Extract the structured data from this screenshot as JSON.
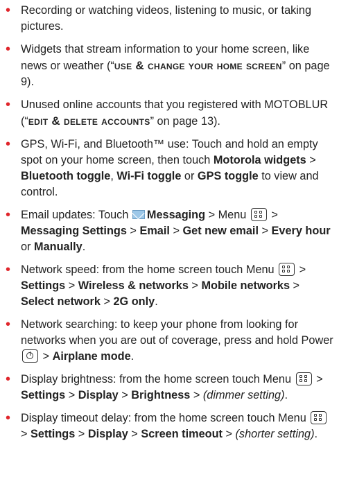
{
  "accent_color": "#e0252b",
  "items": [
    {
      "segments": [
        {
          "t": "Recording or watching videos, listening to music, or taking pictures."
        }
      ]
    },
    {
      "segments": [
        {
          "t": "Widgets that stream information to your home screen, like news or weather (“"
        },
        {
          "t": "Use & Change Your Home Screen",
          "s": "sc"
        },
        {
          "t": "” on page 9)."
        }
      ]
    },
    {
      "segments": [
        {
          "t": "Unused online accounts that you registered with MOTOBLUR (“"
        },
        {
          "t": "Edit & Delete Accounts",
          "s": "sc"
        },
        {
          "t": "” on page 13)."
        }
      ]
    },
    {
      "segments": [
        {
          "t": "GPS, Wi-Fi, and Bluetooth™ use: Touch and hold an empty spot on your home screen, then touch "
        },
        {
          "t": "Motorola widgets",
          "s": "b"
        },
        {
          "t": " > "
        },
        {
          "t": "Bluetooth toggle",
          "s": "b"
        },
        {
          "t": ", "
        },
        {
          "t": "Wi-Fi toggle",
          "s": "b"
        },
        {
          "t": " or "
        },
        {
          "t": "GPS toggle",
          "s": "b"
        },
        {
          "t": " to view and control."
        }
      ]
    },
    {
      "segments": [
        {
          "t": "Email updates: Touch "
        },
        {
          "icon": "mail-icon"
        },
        {
          "t": "Messaging",
          "s": "b"
        },
        {
          "t": " > Menu "
        },
        {
          "icon": "menu-icon"
        },
        {
          "t": " > "
        },
        {
          "t": "Messaging Settings",
          "s": "b"
        },
        {
          "t": " > "
        },
        {
          "t": "Email",
          "s": "b"
        },
        {
          "t": " > "
        },
        {
          "t": "Get new email",
          "s": "b"
        },
        {
          "t": " > "
        },
        {
          "t": "Every hour",
          "s": "b"
        },
        {
          "t": " or "
        },
        {
          "t": "Manually",
          "s": "b"
        },
        {
          "t": "."
        }
      ]
    },
    {
      "segments": [
        {
          "t": "Network speed: from the home screen touch Menu "
        },
        {
          "icon": "menu-icon"
        },
        {
          "t": " > "
        },
        {
          "t": "Settings",
          "s": "b"
        },
        {
          "t": " > "
        },
        {
          "t": "Wireless & networks",
          "s": "b"
        },
        {
          "t": " > "
        },
        {
          "t": "Mobile networks",
          "s": "b"
        },
        {
          "t": " > "
        },
        {
          "t": "Select network",
          "s": "b"
        },
        {
          "t": " > "
        },
        {
          "t": "2G only",
          "s": "b"
        },
        {
          "t": "."
        }
      ]
    },
    {
      "segments": [
        {
          "t": "Network searching: to keep your phone from looking for networks when you are out of coverage, press and hold Power "
        },
        {
          "icon": "power-icon"
        },
        {
          "t": " > "
        },
        {
          "t": "Airplane mode",
          "s": "b"
        },
        {
          "t": "."
        }
      ]
    },
    {
      "segments": [
        {
          "t": "Display brightness: from the home screen touch Menu "
        },
        {
          "icon": "menu-icon"
        },
        {
          "t": " > "
        },
        {
          "t": "Settings",
          "s": "b"
        },
        {
          "t": " > "
        },
        {
          "t": "Display",
          "s": "b"
        },
        {
          "t": " > "
        },
        {
          "t": "Brightness",
          "s": "b"
        },
        {
          "t": " > "
        },
        {
          "t": "(dimmer setting)",
          "s": "i"
        },
        {
          "t": "."
        }
      ]
    },
    {
      "segments": [
        {
          "t": "Display timeout delay: from the home screen touch Menu "
        },
        {
          "icon": "menu-icon"
        },
        {
          "t": " > "
        },
        {
          "t": "Settings",
          "s": "b"
        },
        {
          "t": " > "
        },
        {
          "t": "Display",
          "s": "b"
        },
        {
          "t": " > "
        },
        {
          "t": "Screen timeout",
          "s": "b"
        },
        {
          "t": " > "
        },
        {
          "t": "(shorter setting)",
          "s": "i"
        },
        {
          "t": "."
        }
      ]
    }
  ]
}
